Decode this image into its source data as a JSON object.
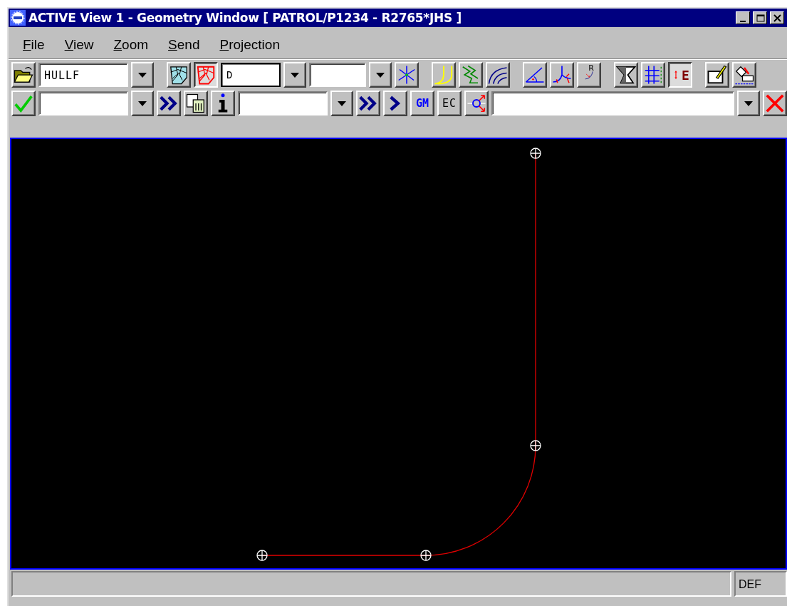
{
  "window": {
    "title": "ACTIVE View 1 - Geometry Window [ PATROL/P1234 - R2765*JHS ]"
  },
  "menu": [
    "File",
    "View",
    "Zoom",
    "Send",
    "Projection"
  ],
  "toolbars": [
    [
      [
        {
          "kind": "button",
          "pressed": false
        },
        {
          "kind": "field",
          "value": "HULLF",
          "focused": false
        },
        {
          "kind": "dropdown"
        }
      ],
      [
        {
          "kind": "button",
          "pressed": false
        },
        {
          "kind": "button",
          "pressed": true
        },
        {
          "kind": "field",
          "value": "D",
          "focused": true
        },
        {
          "kind": "dropdown"
        },
        {
          "kind": "field",
          "focused": false
        },
        {
          "kind": "dropdown"
        },
        {
          "kind": "button",
          "pressed": false
        }
      ],
      [
        {
          "kind": "button",
          "pressed": false
        },
        {
          "kind": "button",
          "pressed": false
        },
        {
          "kind": "button",
          "pressed": false
        }
      ],
      [
        {
          "kind": "button",
          "pressed": false
        },
        {
          "kind": "button",
          "pressed": false
        },
        {
          "kind": "button",
          "pressed": false,
          "label": "R"
        }
      ],
      [
        {
          "kind": "button",
          "pressed": false
        },
        {
          "kind": "button",
          "pressed": false
        },
        {
          "kind": "button",
          "pressed": true,
          "label": "E"
        }
      ],
      [
        {
          "kind": "button",
          "pressed": false
        },
        {
          "kind": "button",
          "pressed": false
        }
      ]
    ],
    [
      [
        {
          "kind": "button",
          "pressed": false
        },
        {
          "kind": "field",
          "focused": false
        },
        {
          "kind": "dropdown"
        },
        {
          "kind": "button",
          "pressed": false
        },
        {
          "kind": "button",
          "pressed": false
        },
        {
          "kind": "button",
          "pressed": false
        },
        {
          "kind": "field",
          "focused": false
        },
        {
          "kind": "dropdown"
        },
        {
          "kind": "button",
          "pressed": false
        },
        {
          "kind": "button",
          "pressed": false
        },
        {
          "kind": "button",
          "pressed": false,
          "label": "GM"
        },
        {
          "kind": "button",
          "pressed": false,
          "label": "EC"
        },
        {
          "kind": "button",
          "pressed": false
        },
        {
          "kind": "field",
          "focused": false
        },
        {
          "kind": "dropdown"
        },
        {
          "kind": "button",
          "pressed": false
        }
      ]
    ]
  ],
  "status_bar": {
    "mode": "DEF"
  }
}
